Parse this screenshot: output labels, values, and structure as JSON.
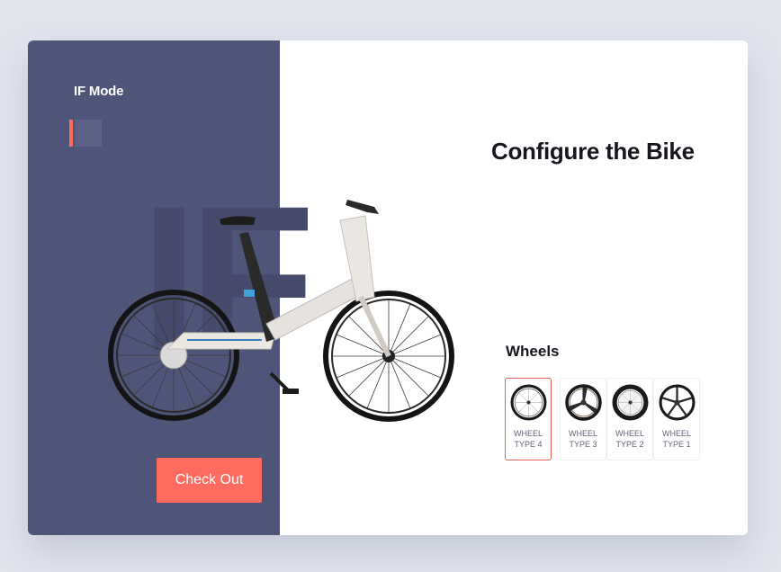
{
  "brand": {
    "name": "IF Mode",
    "watermark": "IF"
  },
  "title": "Configure the Bike",
  "section": {
    "label": "Wheels"
  },
  "wheels": [
    {
      "label": "WHEEL TYPE 4",
      "selected": true,
      "icon": "spoked-wheel-icon"
    },
    {
      "label": "WHEEL TYPE 3",
      "selected": false,
      "icon": "tri-spoke-wheel-icon"
    },
    {
      "label": "WHEEL TYPE 2",
      "selected": false,
      "icon": "deep-rim-wheel-icon"
    },
    {
      "label": "WHEEL TYPE 1",
      "selected": false,
      "icon": "five-spoke-wheel-icon"
    }
  ],
  "checkout": {
    "label": "Check Out"
  },
  "colors": {
    "panel": "#4f5479",
    "accent": "#ff6b5e",
    "background": "#e2e5ee"
  }
}
